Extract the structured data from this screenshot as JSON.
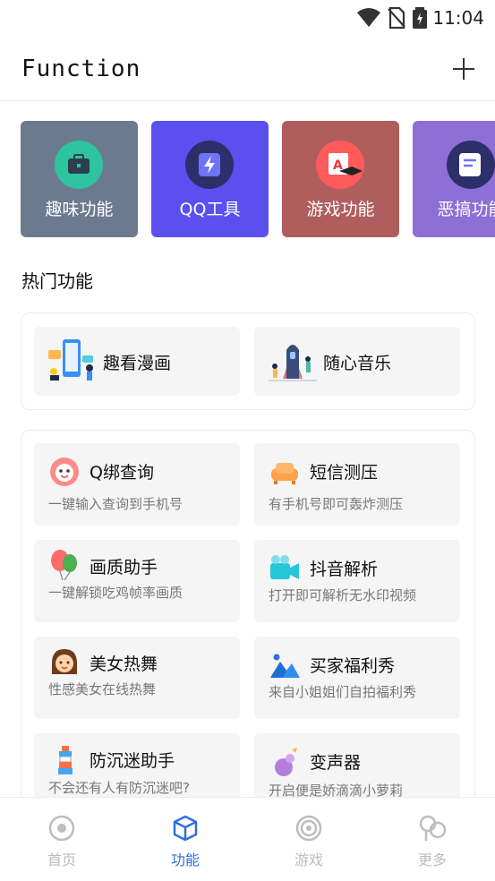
{
  "status": {
    "time": "11:04"
  },
  "header": {
    "title": "Function"
  },
  "categories": [
    {
      "label": "趣味功能",
      "color": "#6b7a8f",
      "icon": "briefcase-icon"
    },
    {
      "label": "QQ工具",
      "color": "#5b4ff0",
      "icon": "lightning-icon"
    },
    {
      "label": "游戏功能",
      "color": "#b05d5d",
      "icon": "grad-cap-icon"
    },
    {
      "label": "恶搞功能",
      "color": "#8d6fd6",
      "icon": "note-icon"
    }
  ],
  "hot": {
    "title": "热门功能",
    "items": [
      {
        "label": "趣看漫画",
        "icon": "comic-illustration-icon"
      },
      {
        "label": "随心音乐",
        "icon": "music-illustration-icon"
      }
    ]
  },
  "features": [
    {
      "title": "Q绑查询",
      "desc": "一键输入查询到手机号",
      "icon": "flower-icon"
    },
    {
      "title": "短信测压",
      "desc": "有手机号即可轰炸测压",
      "icon": "sofa-icon"
    },
    {
      "title": "画质助手",
      "desc": "一键解锁吃鸡帧率画质",
      "icon": "balloon-icon"
    },
    {
      "title": "抖音解析",
      "desc": "打开即可解析无水印视频",
      "icon": "video-camera-icon"
    },
    {
      "title": "美女热舞",
      "desc": "性感美女在线热舞",
      "icon": "girl-icon"
    },
    {
      "title": "买家福利秀",
      "desc": "来自小姐姐们自拍福利秀",
      "icon": "mountain-icon"
    },
    {
      "title": "防沉迷助手",
      "desc": "不会还有人有防沉迷吧?",
      "icon": "lighthouse-icon"
    },
    {
      "title": "变声器",
      "desc": "开启便是娇滴滴小萝莉",
      "icon": "voice-changer-icon"
    }
  ],
  "nav": [
    {
      "label": "首页",
      "icon": "home-target-icon",
      "active": false
    },
    {
      "label": "功能",
      "icon": "cube-icon",
      "active": true
    },
    {
      "label": "游戏",
      "icon": "game-spiral-icon",
      "active": false
    },
    {
      "label": "更多",
      "icon": "more-circles-icon",
      "active": false
    }
  ],
  "colors": {
    "accent": "#2f6fdc",
    "inactive": "#bdbdbd"
  }
}
